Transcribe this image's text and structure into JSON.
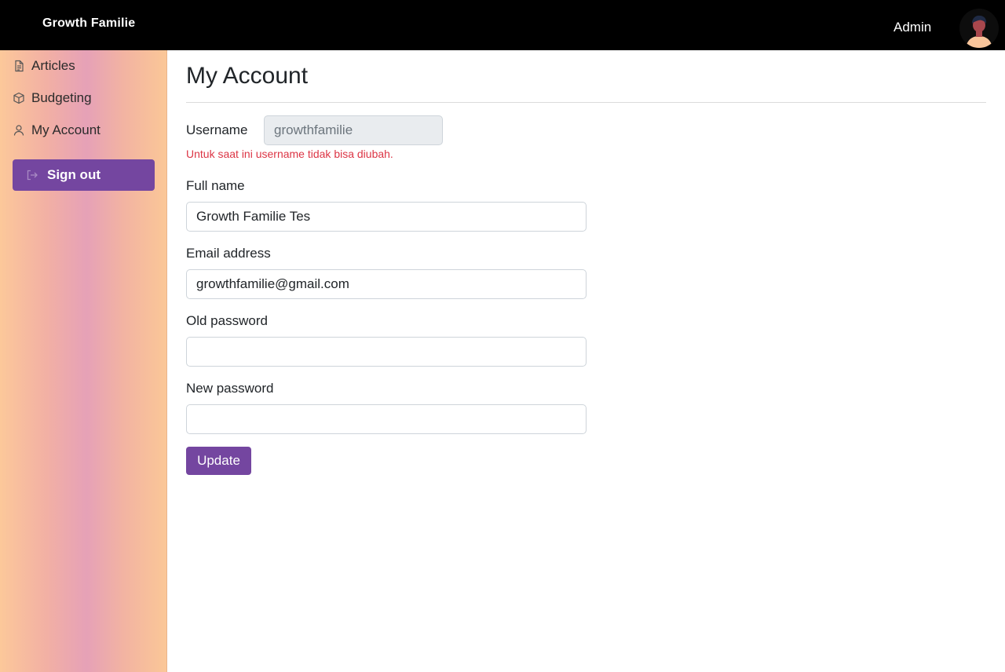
{
  "header": {
    "brand": "Growth Familie",
    "user_name": "Admin",
    "avatar_icon": "user-avatar-icon"
  },
  "sidebar": {
    "items": [
      {
        "label": "Articles",
        "icon": "document-icon"
      },
      {
        "label": "Budgeting",
        "icon": "box-icon"
      },
      {
        "label": "My Account",
        "icon": "person-icon"
      }
    ],
    "signout_label": "Sign out",
    "signout_icon": "logout-icon"
  },
  "page": {
    "title": "My Account"
  },
  "form": {
    "username": {
      "label": "Username",
      "value": "growthfamilie",
      "help": "Untuk saat ini username tidak bisa diubah."
    },
    "full_name": {
      "label": "Full name",
      "value": "Growth Familie Tes"
    },
    "email": {
      "label": "Email address",
      "value": "growthfamilie@gmail.com"
    },
    "old_password": {
      "label": "Old password",
      "value": ""
    },
    "new_password": {
      "label": "New password",
      "value": ""
    },
    "submit_label": "Update"
  },
  "colors": {
    "topbar": "#000000",
    "accent": "#7446a0",
    "error": "#dc3545"
  }
}
